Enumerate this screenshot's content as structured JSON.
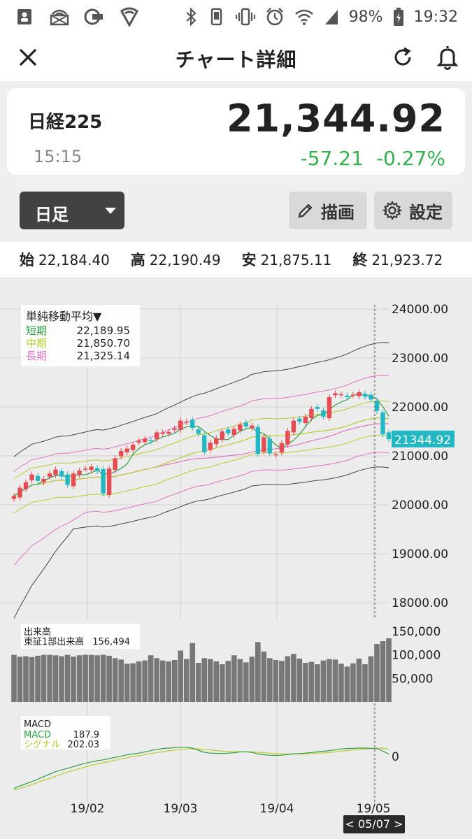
{
  "status": {
    "battery": "98%",
    "time": "19:32"
  },
  "header": {
    "title": "チャート詳細"
  },
  "quote": {
    "name": "日経225",
    "time": "15:15",
    "price": "21,344.92",
    "change": "-57.21",
    "change_pct": "-0.27%"
  },
  "controls": {
    "period": "日足",
    "draw_label": "描画",
    "settings_label": "設定"
  },
  "ohlc": {
    "open_label": "始",
    "open": "22,184.40",
    "high_label": "高",
    "high": "22,190.49",
    "low_label": "安",
    "low": "21,875.11",
    "close_label": "終",
    "close": "21,923.72"
  },
  "chart_data": {
    "type": "candlestick",
    "price_axis_ticks": [
      "24000.00",
      "23000.00",
      "22000.00",
      "21000.00",
      "20000.00",
      "19000.00",
      "18000.00"
    ],
    "last_price_label": "21344.92",
    "x_ticks": [
      "19/02",
      "19/03",
      "19/04",
      "19/05"
    ],
    "sma_legend": {
      "title": "単純移動平均▼",
      "items": [
        {
          "label": "短期",
          "value": "22,189.95",
          "color": "#2ea043"
        },
        {
          "label": "中期",
          "value": "21,850.70",
          "color": "#b9cc2e"
        },
        {
          "label": "長期",
          "value": "21,325.14",
          "color": "#e272c4"
        }
      ]
    },
    "volume_legend": {
      "title": "出来高",
      "subtitle": "東証1部出来高",
      "value": "156,494"
    },
    "volume_axis_ticks": [
      "150,000",
      "100,000",
      "50,000"
    ],
    "macd_legend": {
      "title": "MACD",
      "items": [
        {
          "label": "MACD",
          "value": "187.9",
          "color": "#2ea043"
        },
        {
          "label": "シグナル",
          "value": "202.03",
          "color": "#b9cc2e"
        }
      ]
    },
    "macd_axis_ticks": [
      "0"
    ],
    "selected_date": "< 05/07 >",
    "closes": [
      20180,
      20350,
      20460,
      20620,
      20490,
      20530,
      20640,
      20720,
      20580,
      20410,
      20640,
      20700,
      20740,
      20780,
      20690,
      20230,
      20740,
      20950,
      21100,
      21150,
      21230,
      21310,
      21350,
      21300,
      21480,
      21480,
      21490,
      21560,
      21720,
      21700,
      21570,
      21450,
      21080,
      21270,
      21360,
      21500,
      21460,
      21550,
      21640,
      21600,
      21620,
      21040,
      21380,
      21050,
      21030,
      21260,
      21510,
      21720,
      21700,
      21800,
      21960,
      21960,
      21800,
      22200,
      22280,
      22260,
      22200,
      22250,
      22300,
      22210,
      22150,
      21920,
      21440,
      21340
    ],
    "volumes": [
      100000,
      96000,
      97000,
      95000,
      98000,
      100000,
      100000,
      99000,
      97000,
      100000,
      96000,
      99000,
      100000,
      100000,
      99000,
      100000,
      98000,
      93000,
      90000,
      81000,
      82000,
      86000,
      88000,
      99000,
      93000,
      88000,
      86000,
      89000,
      109000,
      91000,
      125000,
      83000,
      93000,
      91000,
      86000,
      80000,
      87000,
      99000,
      91000,
      84000,
      96000,
      127000,
      107000,
      93000,
      89000,
      87000,
      97000,
      102000,
      92000,
      83000,
      85000,
      80000,
      88000,
      91000,
      90000,
      81000,
      75000,
      82000,
      92000,
      80000,
      97000,
      123000,
      129000,
      135000
    ],
    "macd": [
      -760,
      -700,
      -650,
      -600,
      -540,
      -480,
      -420,
      -360,
      -320,
      -280,
      -240,
      -200,
      -160,
      -130,
      -100,
      -80,
      -50,
      -20,
      10,
      40,
      60,
      80,
      110,
      140,
      170,
      190,
      200,
      210,
      220,
      220,
      200,
      150,
      100,
      80,
      75,
      70,
      80,
      90,
      110,
      110,
      100,
      60,
      40,
      30,
      25,
      30,
      50,
      60,
      70,
      80,
      95,
      110,
      125,
      140,
      160,
      180,
      190,
      195,
      200,
      200,
      195,
      188,
      130,
      60
    ],
    "signal": [
      -800,
      -760,
      -720,
      -670,
      -620,
      -570,
      -520,
      -470,
      -420,
      -370,
      -330,
      -290,
      -250,
      -210,
      -180,
      -150,
      -120,
      -90,
      -60,
      -30,
      0,
      20,
      45,
      70,
      95,
      115,
      135,
      155,
      170,
      180,
      185,
      180,
      170,
      155,
      140,
      130,
      120,
      115,
      112,
      110,
      108,
      100,
      90,
      80,
      70,
      65,
      60,
      60,
      62,
      65,
      70,
      78,
      85,
      95,
      110,
      125,
      140,
      155,
      170,
      180,
      188,
      195,
      200,
      175
    ],
    "grid": true
  }
}
